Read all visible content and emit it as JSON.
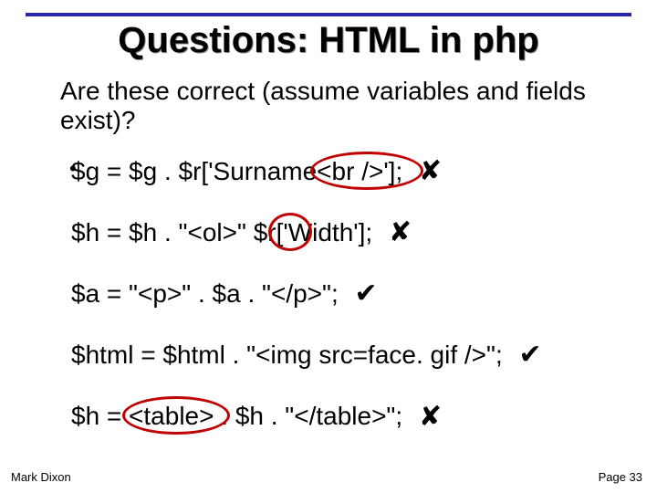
{
  "title": "Questions: HTML in php",
  "question": "Are these correct (assume variables and fields exist)?",
  "lines": {
    "l1": "$g = $g . $r['Surname<br />'];",
    "l2": "$h = $h . \"<ol>\" $r['Width'];",
    "l3": "$a = \"<p>\" . $a . \"</p>\";",
    "l4": "$html = $html . \"<img src=face. gif />\";",
    "l5": "$h = <table> . $h . \"</table>\";"
  },
  "marks": {
    "l1": "✘",
    "l2": "✘",
    "l3": "✔",
    "l4": "✔",
    "l5": "✘"
  },
  "author": "Mark Dixon",
  "page": "Page 33"
}
